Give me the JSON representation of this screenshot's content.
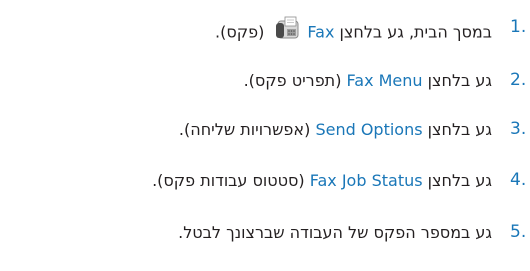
{
  "steps": [
    {
      "number": "1.",
      "before": "במסך הבית, גע בלחצן ",
      "term": "Fax",
      "after": " (פקס).",
      "icon": "fax-icon"
    },
    {
      "number": "2.",
      "before": "גע בלחצן ",
      "term": "Fax Menu",
      "after": " (תפריט פקס)."
    },
    {
      "number": "3.",
      "before": "גע בלחצן ",
      "term": "Send Options",
      "after": " (אפשרויות שליחה)."
    },
    {
      "number": "4.",
      "before": "גע בלחצן ",
      "term": "Fax Job Status",
      "after": " (סטטוס עבודות פקס)."
    },
    {
      "number": "5.",
      "before": "גע במספר הפקס של העבודה שברצונך לבטל.",
      "term": "",
      "after": ""
    }
  ],
  "colors": {
    "accent": "#1a77b8",
    "text": "#231f20"
  }
}
